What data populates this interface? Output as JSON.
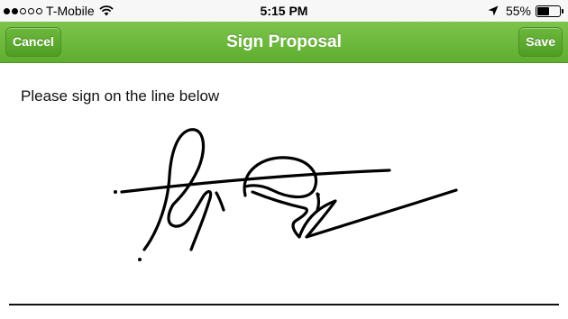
{
  "status_bar": {
    "carrier": "T-Mobile",
    "time": "5:15 PM",
    "battery_percent": "55%",
    "battery_level": 0.55,
    "signal_bars_filled": 2,
    "signal_bars_total": 5,
    "icons": [
      "wifi-icon",
      "location-arrow-icon",
      "battery-icon"
    ]
  },
  "nav": {
    "title": "Sign Proposal",
    "cancel_label": "Cancel",
    "save_label": "Save",
    "accent_color": "#6cb73b"
  },
  "main": {
    "instruction": "Please sign on the line below"
  }
}
